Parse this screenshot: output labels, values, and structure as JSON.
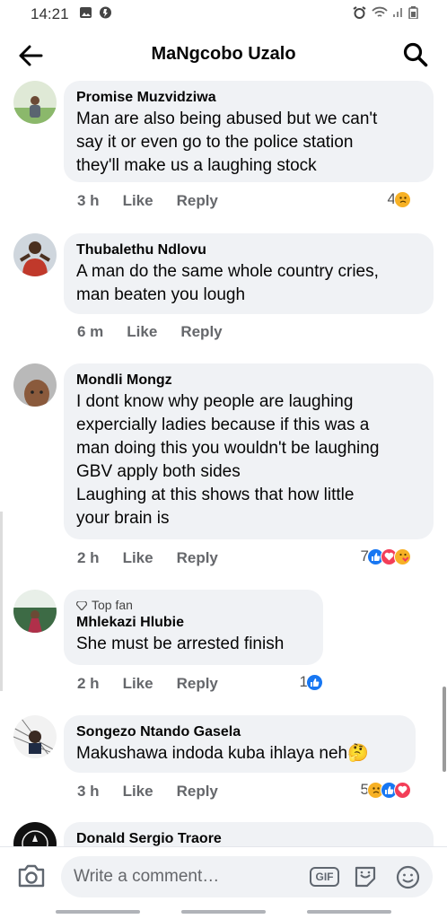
{
  "status_bar": {
    "time": "14:21"
  },
  "header": {
    "title": "MaNgcobo Uzalo"
  },
  "comments": [
    {
      "author": "Promise Muzvidziwa",
      "text": "Man are also being abused but we can't\nsay it or even go to the police station\nthey'll make us a laughing stock",
      "time": "3 h",
      "like": "Like",
      "reply": "Reply",
      "reaction_count": "4"
    },
    {
      "author": "Thubalethu Ndlovu",
      "text": "A man do the same whole country cries,\nman beaten you lough",
      "time": "6 m",
      "like": "Like",
      "reply": "Reply",
      "reaction_count": ""
    },
    {
      "author": "Mondli Mongz",
      "text": "I dont know why people are laughing\nexpercially ladies because if this was a\nman doing this you wouldn't be laughing\nGBV apply both sides\nLaughing at this shows that how little\nyour brain is",
      "time": "2 h",
      "like": "Like",
      "reply": "Reply",
      "reaction_count": "7"
    },
    {
      "badge": "Top fan",
      "author": "Mhlekazi Hlubie",
      "text": "She must be arrested finish",
      "time": "2 h",
      "like": "Like",
      "reply": "Reply",
      "reaction_count": "1"
    },
    {
      "author": "Songezo Ntando Gasela",
      "text": "Makushawa indoda kuba ihlaya neh🤔",
      "time": "3 h",
      "like": "Like",
      "reply": "Reply",
      "reaction_count": "5"
    },
    {
      "author": "Donald Sergio Traore",
      "text": ""
    }
  ],
  "composer": {
    "placeholder": "Write a comment…",
    "gif_label": "GIF"
  },
  "colors": {
    "like_blue": "#1877f2",
    "love_red": "#f33e58",
    "sad_yellow": "#f7b125",
    "bubble_bg": "#f0f2f5",
    "meta_gray": "#65676b"
  },
  "icons": [
    "back-arrow-icon",
    "search-icon",
    "camera-icon",
    "gif-icon",
    "sticker-icon",
    "emoji-icon",
    "like-reaction-icon",
    "love-reaction-icon",
    "sad-reaction-icon",
    "care-reaction-icon",
    "top-fan-gem-icon"
  ]
}
